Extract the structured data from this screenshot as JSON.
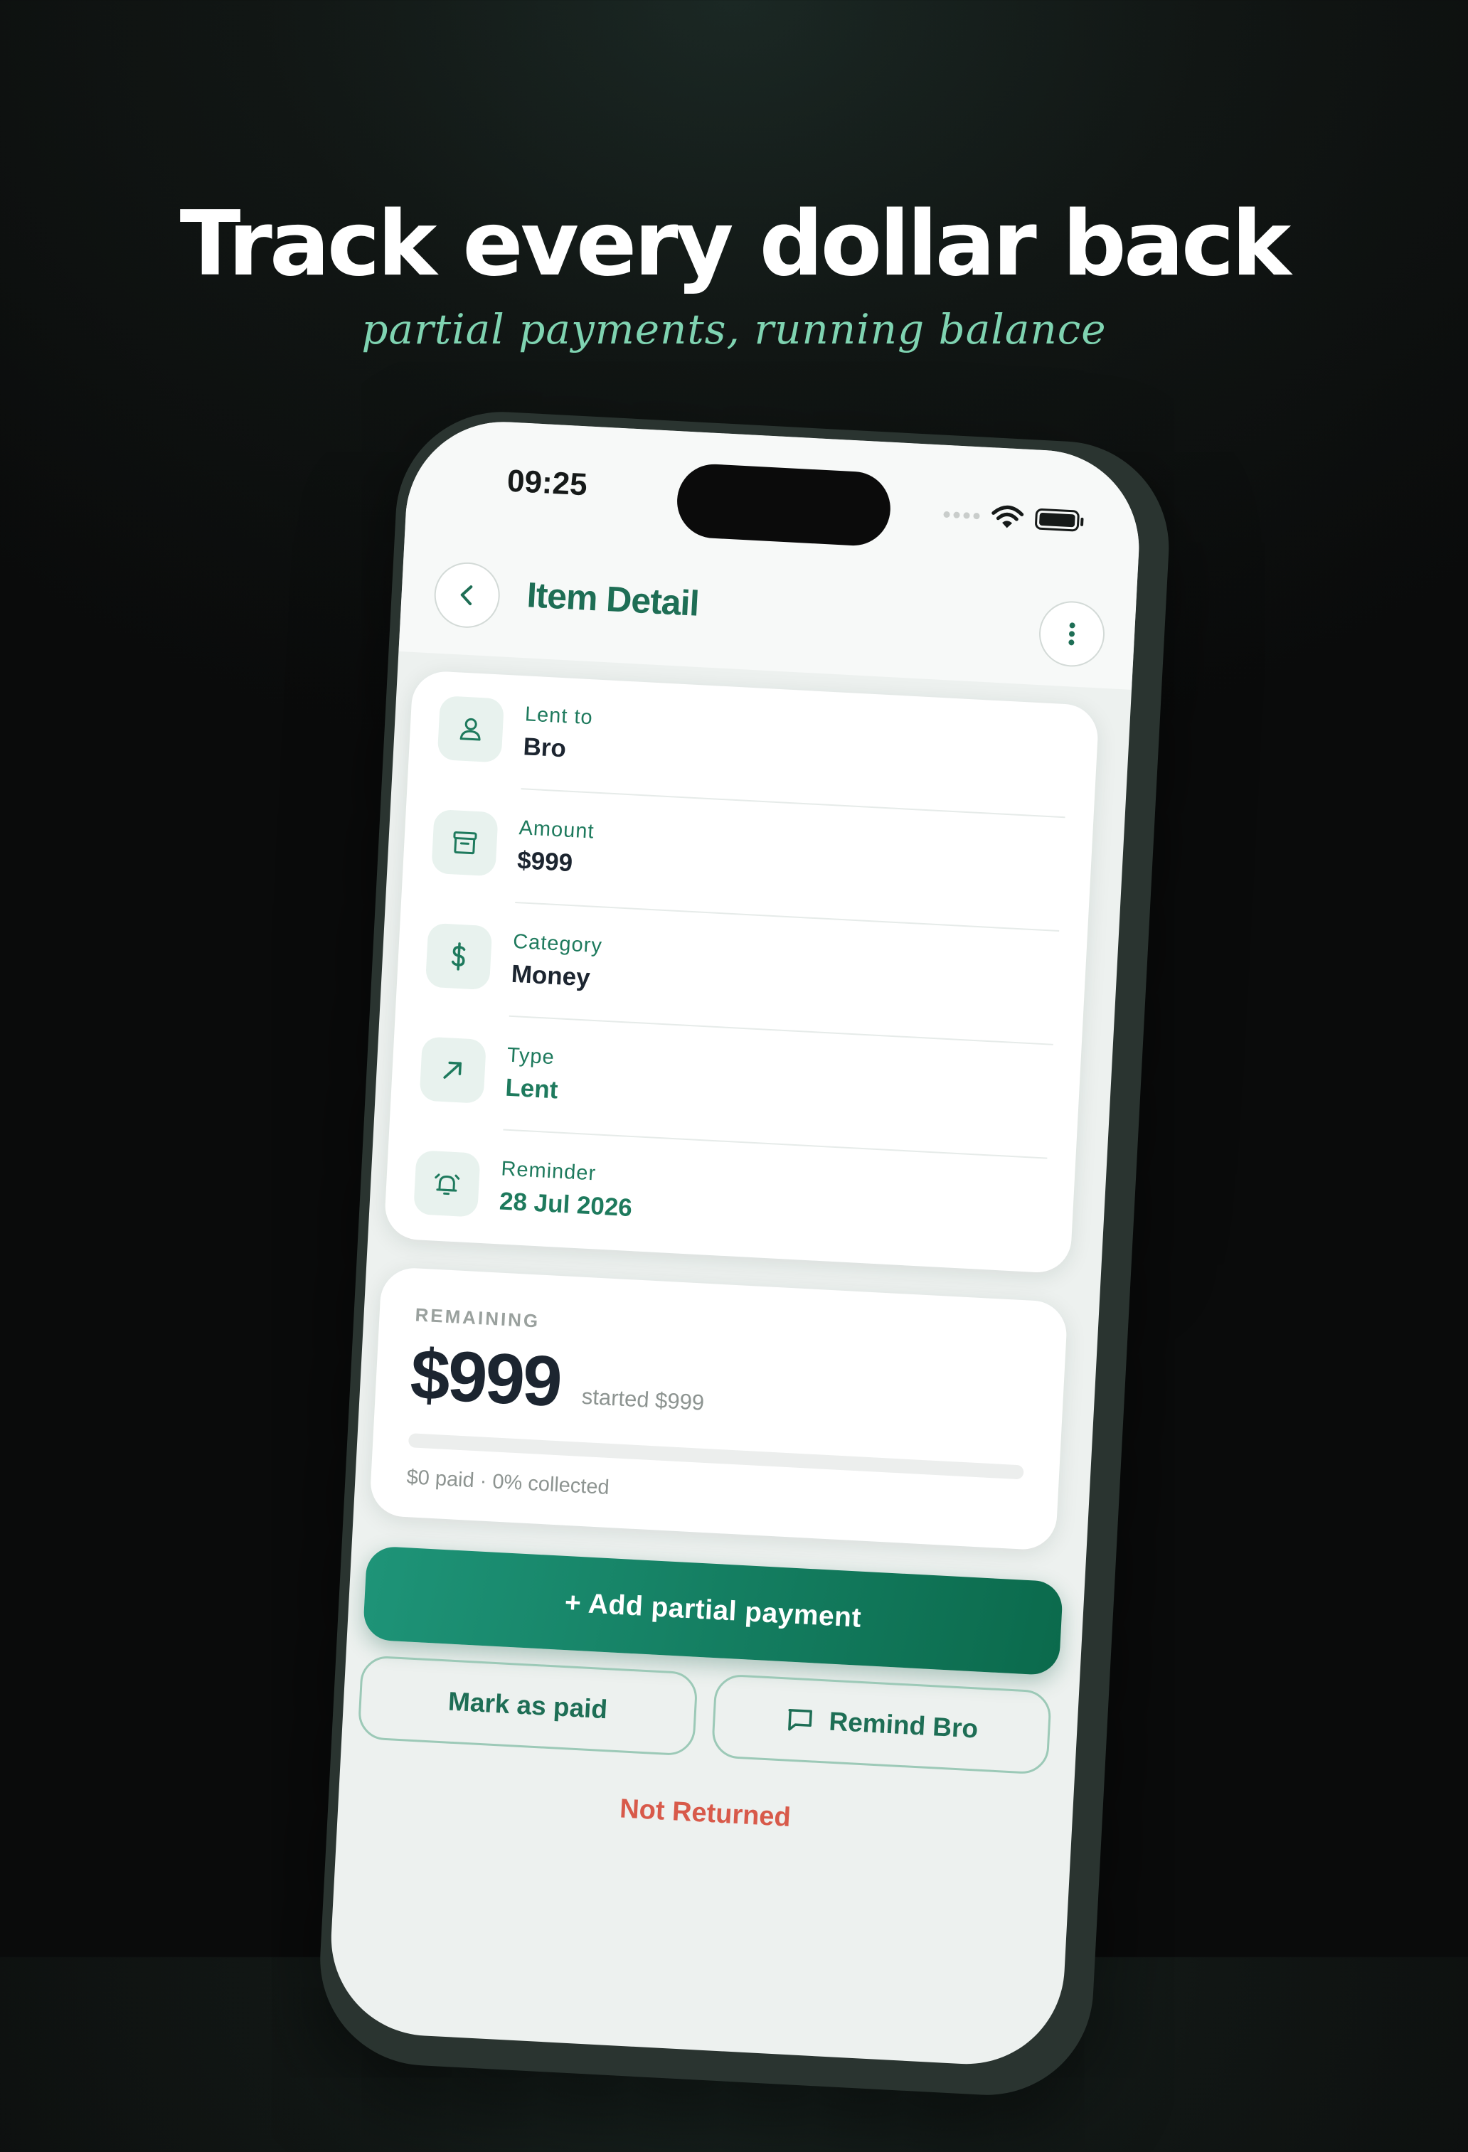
{
  "hero": {
    "title": "Track every dollar back",
    "subtitle": "partial payments, running balance"
  },
  "status_bar": {
    "time": "09:25"
  },
  "header": {
    "title": "Item Detail"
  },
  "details": [
    {
      "label": "Lent to",
      "value": "Bro",
      "icon": "person-icon"
    },
    {
      "label": "Amount",
      "value": "$999",
      "icon": "box-icon"
    },
    {
      "label": "Category",
      "value": "Money",
      "icon": "dollar-icon"
    },
    {
      "label": "Type",
      "value": "Lent",
      "icon": "arrow-up-right-icon"
    },
    {
      "label": "Reminder",
      "value": "28 Jul 2026",
      "icon": "alarm-icon"
    }
  ],
  "remaining": {
    "label": "REMAINING",
    "amount": "$999",
    "started": "started $999",
    "summary": "$0 paid · 0% collected",
    "progress_fraction": 0
  },
  "actions": {
    "add_payment": "+ Add partial payment",
    "mark_paid": "Mark as paid",
    "remind": "Remind Bro"
  },
  "item_status": "Not Returned",
  "colors": {
    "accent": "#1e7a5d",
    "danger": "#d85a4a",
    "background": "#0a0b0b"
  }
}
